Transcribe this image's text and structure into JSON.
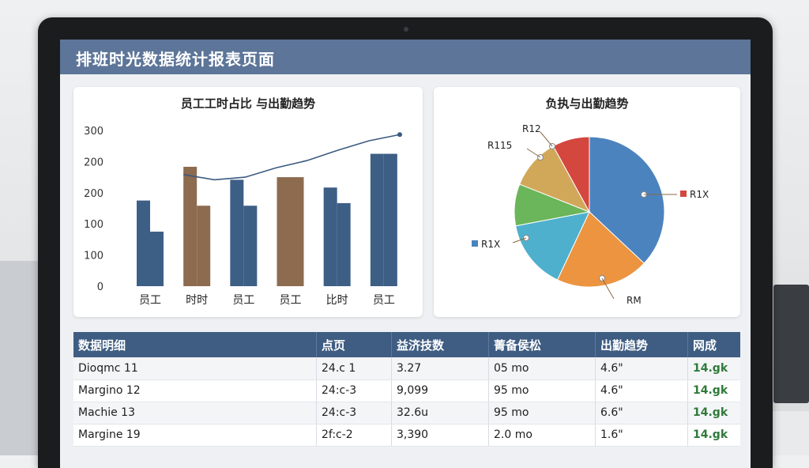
{
  "page": {
    "title": "排班时光数据统计报表页面"
  },
  "left_chart": {
    "title": "员工工时占比 与出勤趋势",
    "y_ticks": [
      "300",
      "200",
      "200",
      "100",
      "100",
      "0"
    ],
    "categories": [
      "员工",
      "时时",
      "员工",
      "员工",
      "比时",
      "员工"
    ]
  },
  "right_chart": {
    "title": "负执与出勤趋势",
    "labels": [
      {
        "text": "R12",
        "color": "#222222"
      },
      {
        "text": "R115",
        "color": "#222222"
      },
      {
        "text": "R1X",
        "color": "#222222"
      },
      {
        "text": "R1X",
        "color": "#222222"
      },
      {
        "text": "RM",
        "color": "#222222"
      }
    ]
  },
  "chart_data": [
    {
      "type": "bar",
      "title": "员工工时占比 与出勤趋势",
      "categories": [
        "员工",
        "时时",
        "员工",
        "员工",
        "比时",
        "员工"
      ],
      "series": [
        {
          "values": [
            165,
            230,
            205,
            210,
            190,
            255
          ],
          "colors": [
            "#3d5f86",
            "#8d6b4f",
            "#3d5f86",
            "#8d6b4f",
            "#3d5f86",
            "#3d5f86"
          ]
        },
        {
          "values": [
            105,
            155,
            155,
            210,
            160,
            255
          ],
          "colors": [
            "#3d5f86",
            "#8d6b4f",
            "#3d5f86",
            "#8d6b4f",
            "#3d5f86",
            "#3d5f86"
          ]
        }
      ],
      "line": {
        "values": [
          215,
          205,
          210,
          228,
          242,
          262,
          280,
          292
        ],
        "color": "#3b5a80"
      },
      "ylim": [
        0,
        300
      ]
    },
    {
      "type": "pie",
      "title": "负执与出勤趋势",
      "slices": [
        {
          "value": 37,
          "color": "#4b83bf"
        },
        {
          "value": 20,
          "color": "#ec9440"
        },
        {
          "value": 15,
          "color": "#4fb0cd"
        },
        {
          "value": 9,
          "color": "#6bb55a"
        },
        {
          "value": 11,
          "color": "#d1a85a"
        },
        {
          "value": 8,
          "color": "#d4473f"
        }
      ]
    }
  ],
  "table": {
    "headers": [
      "数据明细",
      "点页",
      "益济技数",
      "菁备侯松",
      "出勤趋势",
      "网成"
    ],
    "rows": [
      [
        "Dioqmc 11",
        "24.c 1",
        "3.27",
        "05 mo",
        "4.6\"",
        "14.gk"
      ],
      [
        "Margino 12",
        "24:c-3",
        "9,099",
        "95 mo",
        "4.6\"",
        "14.gk"
      ],
      [
        "Machie 13",
        "24:c-3",
        "32.6u",
        "95 mo",
        "6.6\"",
        "14.gk"
      ],
      [
        "Margine 19",
        "2f:c-2",
        "3,390",
        "2.0 mo",
        "1.6\"",
        "14.gk"
      ]
    ]
  }
}
